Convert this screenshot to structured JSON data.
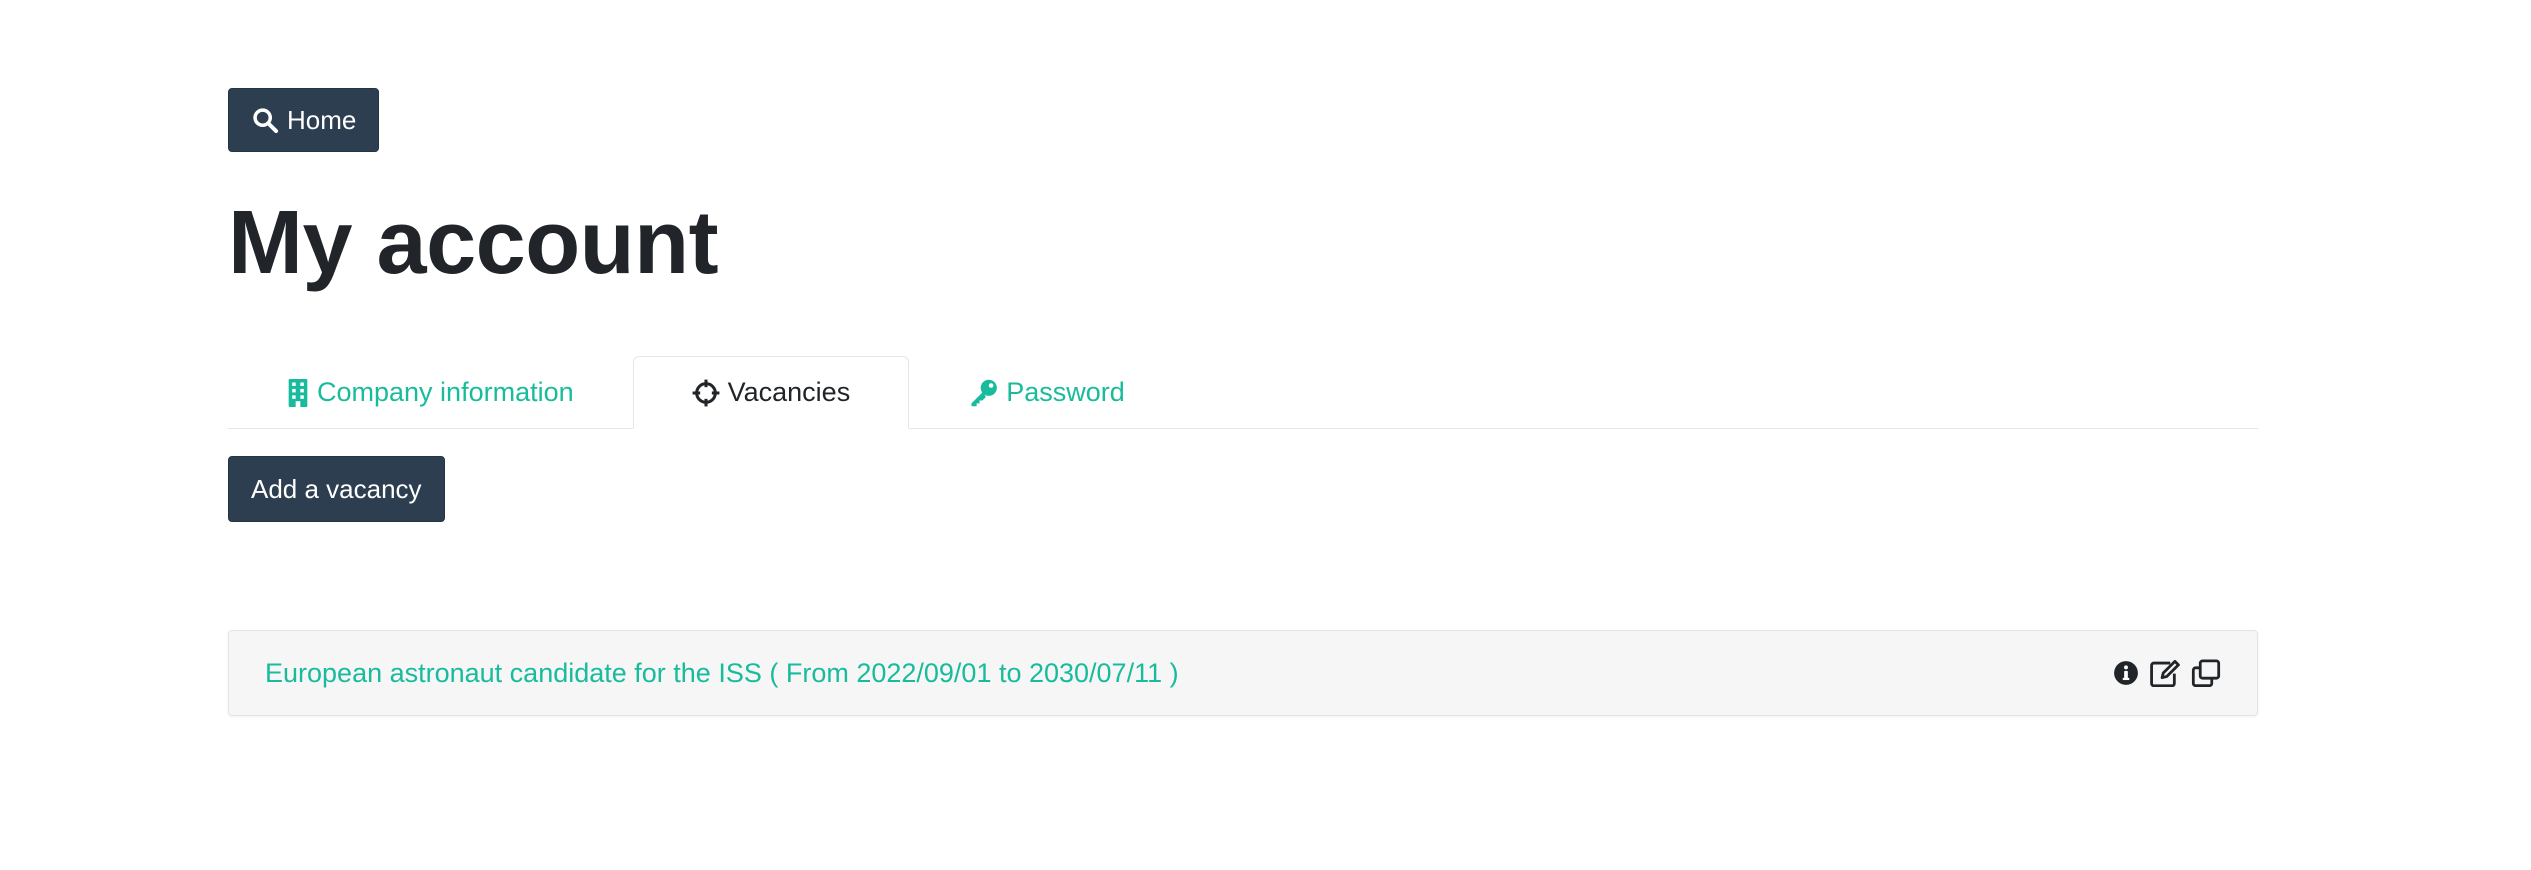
{
  "header": {
    "home_button_label": "Home",
    "home_icon": "search-icon"
  },
  "page": {
    "title": "My account"
  },
  "tabs": [
    {
      "label": "Company information",
      "icon": "building-icon",
      "active": false
    },
    {
      "label": "Vacancies",
      "icon": "crosshairs-icon",
      "active": true
    },
    {
      "label": "Password",
      "icon": "key-icon",
      "active": false
    }
  ],
  "actions": {
    "add_vacancy_label": "Add a vacancy"
  },
  "vacancies": [
    {
      "title": "European astronaut candidate for the ISS ( From 2022/09/01 to 2030/07/11 )",
      "icons": [
        "info-circle-icon",
        "edit-icon",
        "copy-icon"
      ]
    }
  ],
  "colors": {
    "accent": "#18bc9c",
    "dark_button": "#2c3e50",
    "text": "#212529",
    "card_background": "#f6f6f6"
  }
}
